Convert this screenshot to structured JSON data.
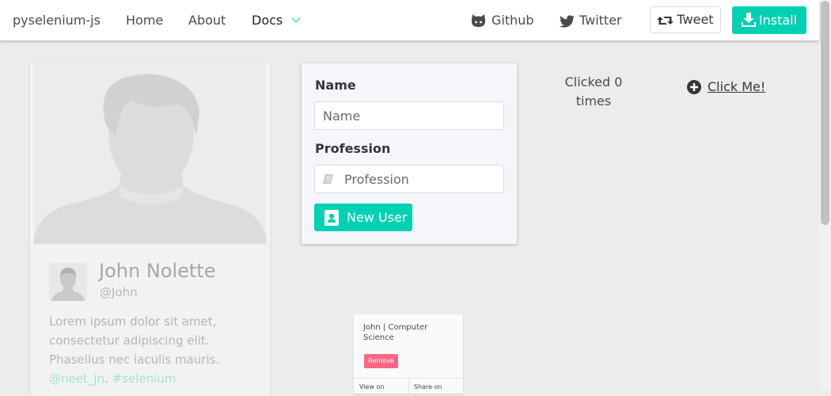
{
  "navbar": {
    "brand": "pyselenium-js",
    "links": [
      "Home",
      "About"
    ],
    "docs_label": "Docs",
    "github_label": "Github",
    "twitter_label": "Twitter",
    "tweet_label": "Tweet",
    "install_label": "Install"
  },
  "profile": {
    "name": "John Nolette",
    "handle": "@John",
    "bio": "Lorem ipsum dolor sit amet, consectetur adipiscing elit. Phasellus nec iaculis mauris.",
    "tags": [
      "@neet_jn",
      "#selenium"
    ]
  },
  "form": {
    "name_label": "Name",
    "name_placeholder": "Name",
    "profession_label": "Profession",
    "profession_placeholder": "Profession",
    "submit_label": "New User"
  },
  "counter": {
    "clicked_text": "Clicked 0 times",
    "click_label": "Click Me!"
  },
  "mini_card": {
    "title": "John | Computer Science",
    "remove_label": "Remove",
    "footer_left": "View on",
    "footer_right": "Share on"
  },
  "colors": {
    "primary": "#00d1b2",
    "danger": "#ff6685",
    "background": "#ececec"
  }
}
